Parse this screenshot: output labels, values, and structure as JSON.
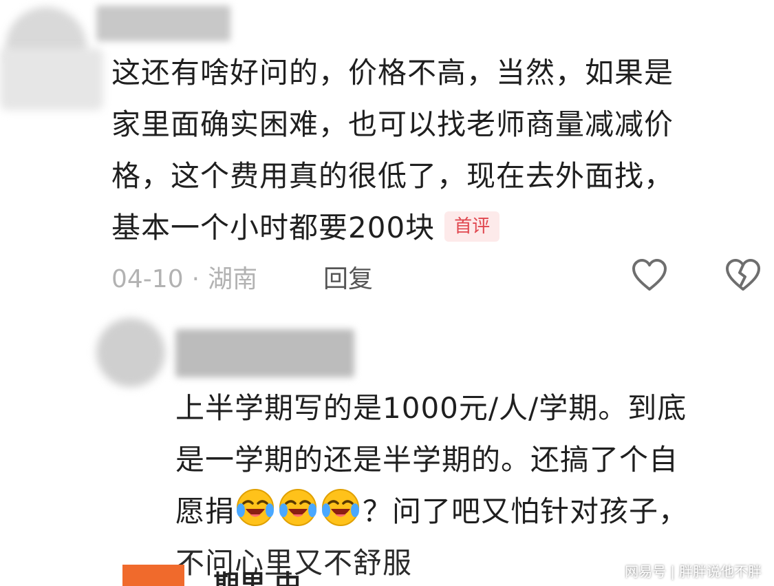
{
  "comments": [
    {
      "lines": [
        "这还有啥好问的，价格不高，当然，如果是",
        "家里面确实困难，也可以找老师商量减减价",
        "格，这个费用真的很低了，现在去外面找，",
        "基本一个小时都要200块"
      ],
      "badge": "首评",
      "date": "04-10",
      "separator": "·",
      "location": "湖南",
      "reply_label": "回复",
      "like_icon": "heart-outline-icon",
      "dislike_icon": "broken-heart-icon"
    },
    {
      "lines": [
        "上半学期写的是1000元/人/学期。到底",
        "是一学期的还是半学期的。还搞了个自"
      ],
      "line3_prefix": "愿捐",
      "line3_emoji": [
        "laughing-crying-emoji",
        "laughing-crying-emoji",
        "laughing-crying-emoji"
      ],
      "line3_suffix": "？问了吧又怕针对孩子，",
      "line4": "不问心里又不舒服"
    }
  ],
  "bottom": {
    "text": "期里 中"
  },
  "watermark": {
    "source": "网易号",
    "separator": "|",
    "author": "胖胖说他不胖"
  },
  "colors": {
    "badge_bg": "#fdeaea",
    "badge_text": "#e0464e",
    "meta_text": "#b2b2b2",
    "accent_orange": "#f06a2c"
  }
}
